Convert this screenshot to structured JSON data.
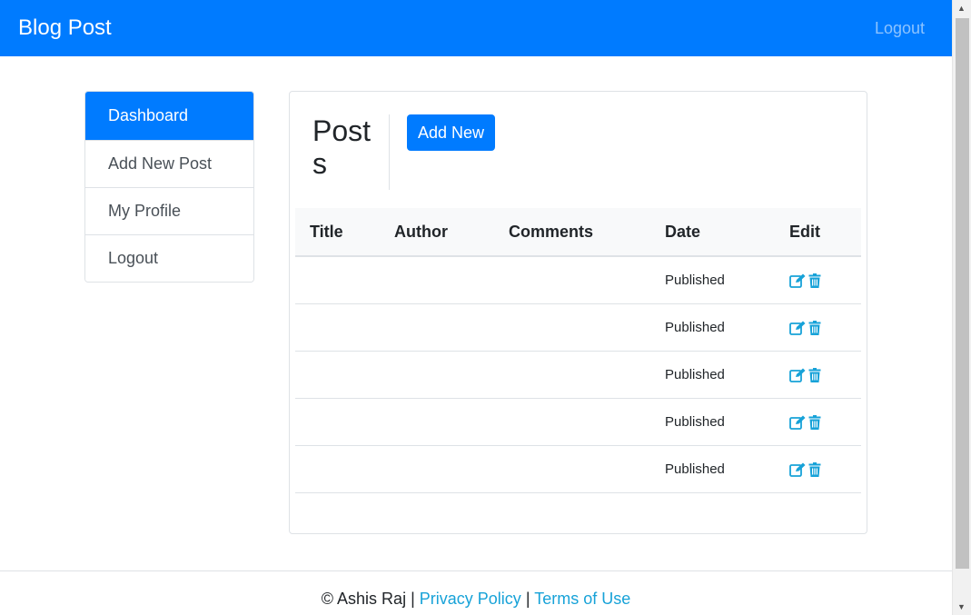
{
  "navbar": {
    "brand": "Blog Post",
    "logout": "Logout"
  },
  "sidebar": {
    "items": [
      {
        "label": "Dashboard",
        "active": true
      },
      {
        "label": "Add New Post",
        "active": false
      },
      {
        "label": "My Profile",
        "active": false
      },
      {
        "label": "Logout",
        "active": false
      }
    ]
  },
  "main": {
    "title": "Posts",
    "add_new_label": "Add New",
    "table": {
      "headers": [
        "Title",
        "Author",
        "Comments",
        "Date",
        "Edit"
      ],
      "rows": [
        {
          "title": "",
          "author": "",
          "comments": "",
          "date": "Published"
        },
        {
          "title": "",
          "author": "",
          "comments": "",
          "date": "Published"
        },
        {
          "title": "",
          "author": "",
          "comments": "",
          "date": "Published"
        },
        {
          "title": "",
          "author": "",
          "comments": "",
          "date": "Published"
        },
        {
          "title": "",
          "author": "",
          "comments": "",
          "date": "Published"
        }
      ]
    }
  },
  "footer": {
    "copyright": "© Ashis Raj",
    "separator": "|",
    "privacy": "Privacy Policy",
    "terms": "Terms of Use"
  },
  "icons": {
    "edit": "edit-icon",
    "delete": "trash-icon"
  },
  "colors": {
    "primary": "#007bff",
    "link": "#17a2d8"
  }
}
